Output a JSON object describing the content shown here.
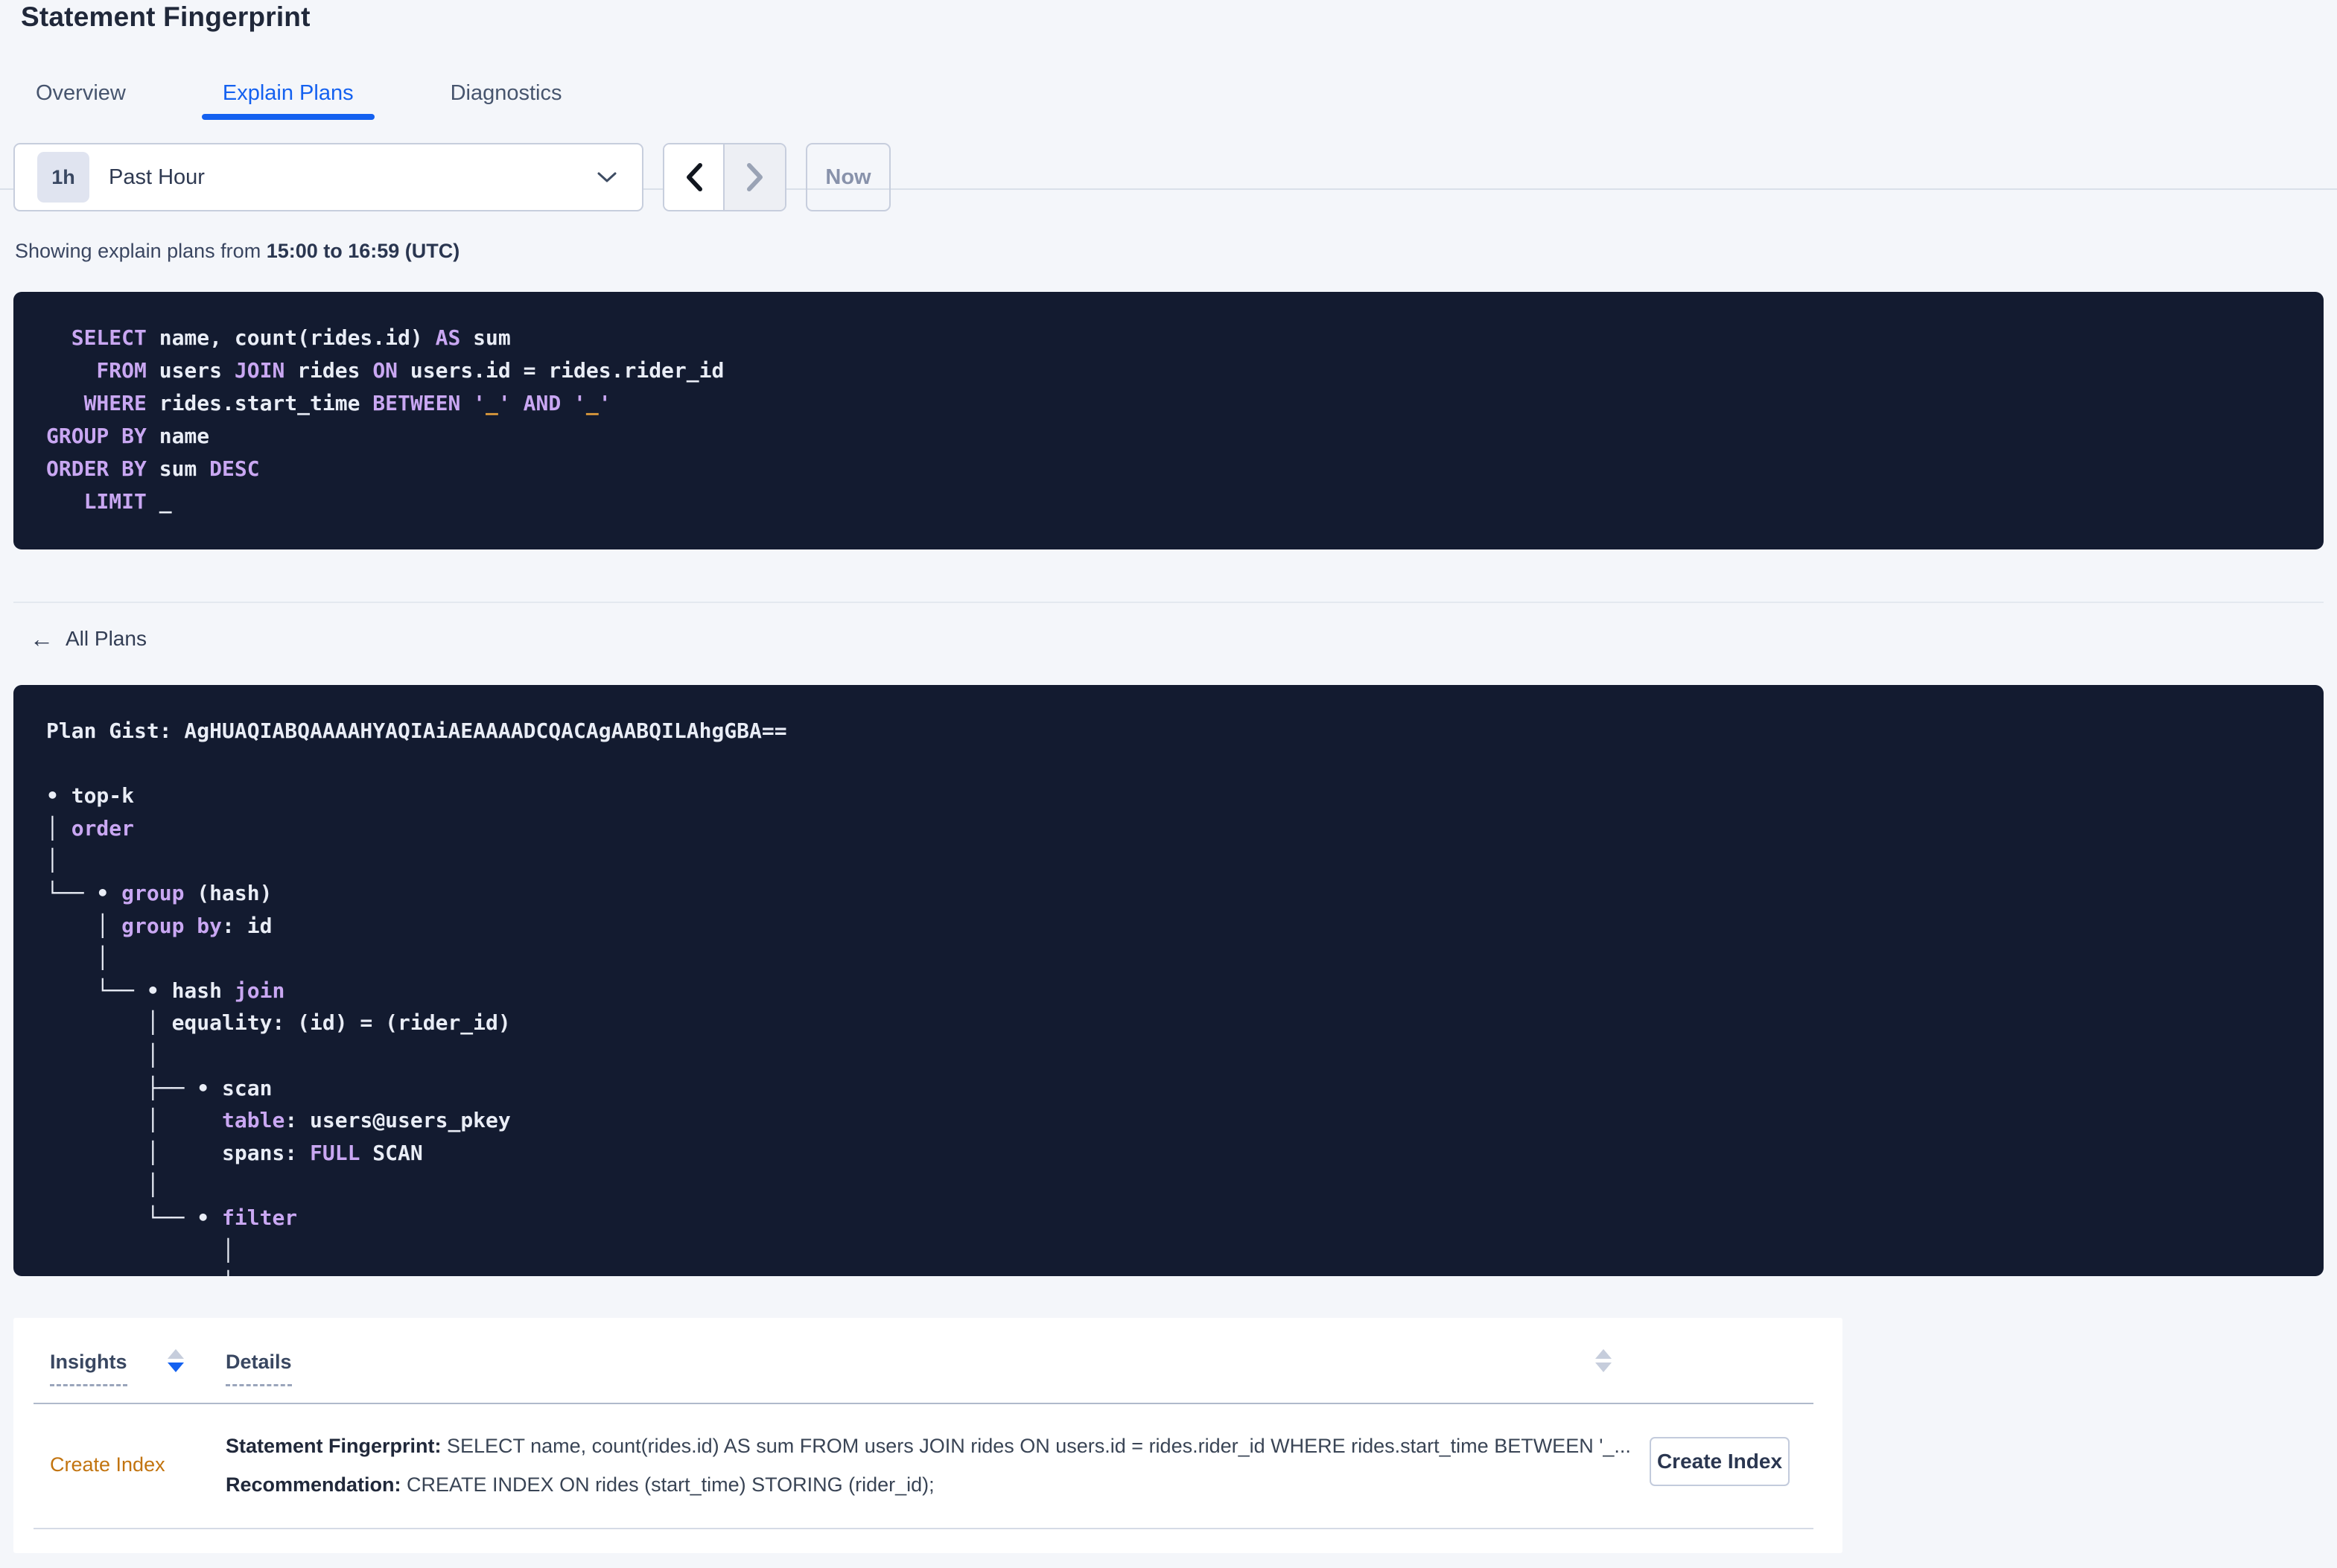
{
  "page": {
    "title": "Statement Fingerprint"
  },
  "tabs": [
    {
      "label": "Overview",
      "active": false
    },
    {
      "label": "Explain Plans",
      "active": true
    },
    {
      "label": "Diagnostics",
      "active": false
    }
  ],
  "time_picker": {
    "badge": "1h",
    "label": "Past Hour"
  },
  "nav": {
    "now_label": "Now"
  },
  "showing": {
    "prefix": "Showing explain plans from ",
    "range": "15:00 to 16:59 (UTC)"
  },
  "colors": {
    "accent_blue": "#1461F0",
    "code_background": "#131B30",
    "code_keyword": "#C9A7F2",
    "code_plain": "#E9EDF6",
    "code_literal": "#E8A13C",
    "insight_orange": "#C2740F",
    "page_background": "#F4F6FA"
  },
  "sql_block": {
    "lines": [
      [
        {
          "c": "k",
          "t": "  SELECT"
        },
        {
          "c": "p",
          "t": " name, count(rides.id) "
        },
        {
          "c": "k",
          "t": "AS"
        },
        {
          "c": "p",
          "t": " sum"
        }
      ],
      [
        {
          "c": "k",
          "t": "    FROM"
        },
        {
          "c": "p",
          "t": " users "
        },
        {
          "c": "k",
          "t": "JOIN"
        },
        {
          "c": "p",
          "t": " rides "
        },
        {
          "c": "k",
          "t": "ON"
        },
        {
          "c": "p",
          "t": " users.id = rides.rider_id"
        }
      ],
      [
        {
          "c": "k",
          "t": "   WHERE"
        },
        {
          "c": "p",
          "t": " rides.start_time "
        },
        {
          "c": "k",
          "t": "BETWEEN"
        },
        {
          "c": "p",
          "t": " "
        },
        {
          "c": "k",
          "t": "'"
        },
        {
          "c": "o",
          "t": "_"
        },
        {
          "c": "k",
          "t": "'"
        },
        {
          "c": "p",
          "t": " "
        },
        {
          "c": "k",
          "t": "AND"
        },
        {
          "c": "p",
          "t": " "
        },
        {
          "c": "k",
          "t": "'"
        },
        {
          "c": "o",
          "t": "_"
        },
        {
          "c": "k",
          "t": "'"
        }
      ],
      [
        {
          "c": "k",
          "t": "GROUP BY"
        },
        {
          "c": "p",
          "t": " name"
        }
      ],
      [
        {
          "c": "k",
          "t": "ORDER BY"
        },
        {
          "c": "p",
          "t": " sum "
        },
        {
          "c": "k",
          "t": "DESC"
        }
      ],
      [
        {
          "c": "k",
          "t": "   LIMIT"
        },
        {
          "c": "p",
          "t": " _"
        }
      ]
    ]
  },
  "all_plans": {
    "label": "All Plans",
    "arrow": "←"
  },
  "plan_block": {
    "lines": [
      [
        {
          "c": "p",
          "t": "Plan Gist: AgHUAQIABQAAAAHYAQIAiAEAAAADCQACAgAABQILAhgGBA=="
        }
      ],
      [],
      [
        {
          "c": "p",
          "t": "• top-k"
        }
      ],
      [
        {
          "c": "p",
          "t": "│ "
        },
        {
          "c": "k",
          "t": "order"
        }
      ],
      [
        {
          "c": "p",
          "t": "│"
        }
      ],
      [
        {
          "c": "p",
          "t": "└── • "
        },
        {
          "c": "k",
          "t": "group"
        },
        {
          "c": "p",
          "t": " (hash)"
        }
      ],
      [
        {
          "c": "p",
          "t": "    │ "
        },
        {
          "c": "k",
          "t": "group by"
        },
        {
          "c": "p",
          "t": ": id"
        }
      ],
      [
        {
          "c": "p",
          "t": "    │"
        }
      ],
      [
        {
          "c": "p",
          "t": "    └── • hash "
        },
        {
          "c": "k",
          "t": "join"
        }
      ],
      [
        {
          "c": "p",
          "t": "        │ equality: (id) = (rider_id)"
        }
      ],
      [
        {
          "c": "p",
          "t": "        │"
        }
      ],
      [
        {
          "c": "p",
          "t": "        ├── • scan"
        }
      ],
      [
        {
          "c": "p",
          "t": "        │     "
        },
        {
          "c": "k",
          "t": "table"
        },
        {
          "c": "p",
          "t": ": users@users_pkey"
        }
      ],
      [
        {
          "c": "p",
          "t": "        │     spans: "
        },
        {
          "c": "k",
          "t": "FULL"
        },
        {
          "c": "p",
          "t": " SCAN"
        }
      ],
      [
        {
          "c": "p",
          "t": "        │"
        }
      ],
      [
        {
          "c": "p",
          "t": "        └── • "
        },
        {
          "c": "k",
          "t": "filter"
        }
      ],
      [
        {
          "c": "p",
          "t": "              │"
        }
      ],
      [
        {
          "c": "p",
          "t": "              │"
        }
      ]
    ]
  },
  "insights_table": {
    "columns": {
      "insights": "Insights",
      "details": "Details"
    },
    "row": {
      "insight": "Create Index",
      "detail_1_label": "Statement Fingerprint:",
      "detail_1_text": " SELECT name, count(rides.id) AS sum FROM users JOIN rides ON users.id = rides.rider_id WHERE rides.start_time BETWEEN '_...",
      "detail_2_label": "Recommendation:",
      "detail_2_text": " CREATE INDEX ON rides (start_time) STORING (rider_id);",
      "action_label": "Create Index"
    }
  }
}
